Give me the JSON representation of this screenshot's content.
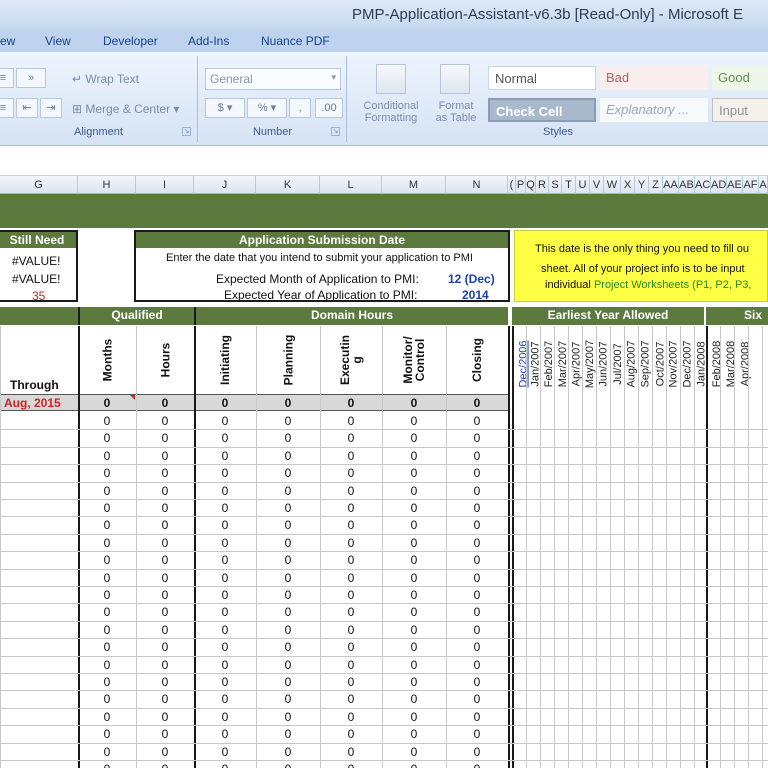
{
  "window": {
    "title": "PMP-Application-Assistant-v6.3b  [Read-Only] - Microsoft E"
  },
  "ribbon_tabs": [
    "ew",
    "View",
    "Developer",
    "Add-Ins",
    "Nuance PDF"
  ],
  "ribbon": {
    "alignment": {
      "wrap_text": "Wrap Text",
      "merge_center": "Merge & Center",
      "label": "Alignment"
    },
    "number": {
      "format": "General",
      "currency": "$",
      "percent": "%",
      "comma": ",",
      "label": "Number"
    },
    "styles": {
      "conditional_formatting": [
        "Conditional",
        "Formatting"
      ],
      "format_as_table": [
        "Format",
        "as Table"
      ],
      "normal": "Normal",
      "bad": "Bad",
      "good": "Good",
      "check_cell": "Check Cell",
      "explanatory": "Explanatory ...",
      "input": "Input",
      "label": "Styles"
    }
  },
  "columns": [
    "G",
    "H",
    "I",
    "J",
    "K",
    "L",
    "M",
    "N",
    "P",
    "Q",
    "R",
    "S",
    "T",
    "U",
    "V",
    "W",
    "X",
    "Y",
    "Z",
    "AA",
    "AB",
    "AC",
    "AD",
    "AE",
    "AF",
    "A"
  ],
  "col_extra": "(",
  "still_need": {
    "title": "Still Need",
    "values": [
      "#VALUE!",
      "#VALUE!",
      "35"
    ]
  },
  "submission": {
    "title": "Application Submission Date",
    "instruction": "Enter the date that you intend to submit your application to PMI",
    "month_label": "Expected Month of Application to PMI:",
    "month_value": "12 (Dec)",
    "year_label": "Expected Year of Application to PMI:",
    "year_value": "2014"
  },
  "note": {
    "line1": "This date is the only thing you need to fill ou",
    "line2": "sheet.  All of your project info is to be input",
    "line3_prefix": "individual",
    "line3_link": "Project Worksheets (P1, P2, P3,"
  },
  "sections": {
    "qualified": "Qualified",
    "domain_hours": "Domain Hours",
    "earliest_year": "Earliest Year Allowed",
    "six": "Six"
  },
  "headers": {
    "through": "Through",
    "months": "Months",
    "hours": "Hours",
    "initiating": "Initiating",
    "planning": "Planning",
    "executing": "Executin g",
    "monitor": "Monitor/ Control",
    "closing": "Closing"
  },
  "months_row": [
    "Dec/2006",
    "Jan/2007",
    "Feb/2007",
    "Mar/2007",
    "Apr/2007",
    "May/2007",
    "Jun/2007",
    "Jul/2007",
    "Aug/2007",
    "Sep/2007",
    "Oct/2007",
    "Nov/2007",
    "Dec/2007",
    "Jan/2008",
    "Feb/2008",
    "Mar/2008",
    "Apr/2008"
  ],
  "totals_row": {
    "through": "Aug, 2015",
    "values": [
      "0",
      "0",
      "0",
      "0",
      "0",
      "0",
      "0"
    ]
  },
  "data_rows": 22,
  "zero": "0",
  "colors": {
    "green": "#5c7a3e",
    "yellow": "#ffff44",
    "red": "#cc2222",
    "blue": "#1a3fb0"
  }
}
